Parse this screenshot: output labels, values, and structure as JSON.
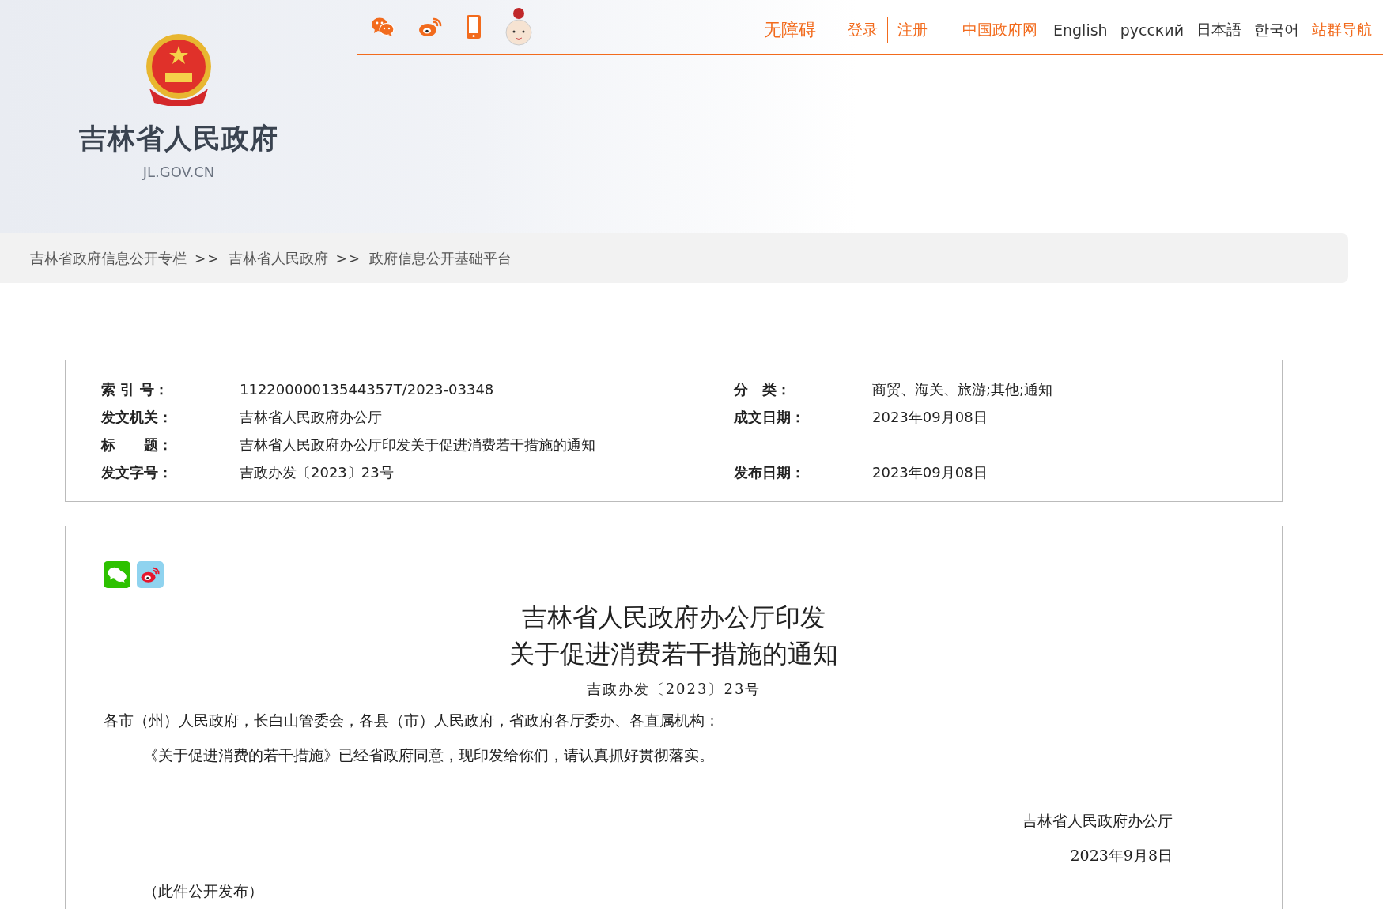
{
  "header": {
    "site_name": "吉林省人民政府",
    "domain": "JL.GOV.CN",
    "nav": [
      {
        "kind": "link",
        "label": "无障碍",
        "color": "#f26b1d"
      },
      {
        "kind": "account",
        "items": [
          "登录",
          "注册"
        ],
        "color": "#f26b1d"
      },
      {
        "kind": "link",
        "label": "中国政府网",
        "color": "#f26b1d"
      },
      {
        "kind": "link",
        "label": "English",
        "color": "#333333"
      },
      {
        "kind": "link",
        "label": "русский",
        "color": "#333333"
      },
      {
        "kind": "link",
        "label": "日本語",
        "color": "#333333"
      },
      {
        "kind": "link",
        "label": "한국어",
        "color": "#333333"
      },
      {
        "kind": "link",
        "label": "站群导航",
        "color": "#f26b1d"
      }
    ]
  },
  "breadcrumb": [
    {
      "kind": "link",
      "text": "吉林省政府信息公开专栏"
    },
    {
      "kind": "separator",
      "text": ">>"
    },
    {
      "kind": "link",
      "text": "吉林省人民政府"
    },
    {
      "kind": "separator",
      "text": ">>"
    },
    {
      "kind": "link",
      "text": "政府信息公开基础平台"
    }
  ],
  "metadata": [
    {
      "left": {
        "label": "索 引 号：",
        "value": "11220000013544357T/2023-03348"
      },
      "right": {
        "label": "分　类：",
        "value": "商贸、海关、旅游;其他;通知"
      }
    },
    {
      "left": {
        "label": "发文机关：",
        "value": "吉林省人民政府办公厅"
      },
      "right": {
        "label": "成文日期：",
        "value": "2023年09月08日"
      }
    },
    {
      "left": {
        "label": "标　　题：",
        "value": "吉林省人民政府办公厅印发关于促进消费若干措施的通知"
      }
    },
    {
      "left": {
        "label": "发文字号：",
        "value": "吉政办发〔2023〕23号"
      },
      "right": {
        "label": "发布日期：",
        "value": "2023年09月08日"
      }
    }
  ],
  "article": {
    "title_lines": [
      "吉林省人民政府办公厅印发",
      "关于促进消费若干措施的通知"
    ],
    "doc_number": "吉政办发〔2023〕23号",
    "salutation": "各市（州）人民政府，长白山管委会，各县（市）人民政府，省政府各厅委办、各直属机构：",
    "paragraphs": [
      "《关于促进消费的若干措施》已经省政府同意，现印发给你们，请认真抓好贯彻落实。"
    ],
    "signature": "吉林省人民政府办公厅",
    "date": "2023年9月8日",
    "note": "（此件公开发布）"
  }
}
